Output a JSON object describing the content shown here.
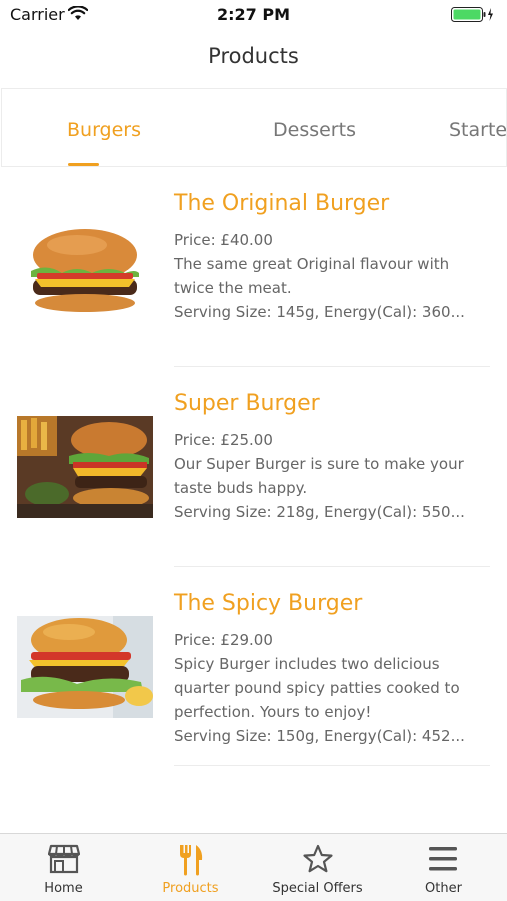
{
  "status_bar": {
    "carrier": "Carrier",
    "time": "2:27 PM"
  },
  "nav": {
    "title": "Products"
  },
  "categories": [
    {
      "label": "Burgers",
      "active": true
    },
    {
      "label": "Desserts",
      "active": false
    },
    {
      "label": "Starters",
      "active": false
    }
  ],
  "products": [
    {
      "name": "The Original Burger",
      "price": "Price: £40.00",
      "description": "The same great Original flavour with twice the meat.",
      "serving": "Serving Size: 145g, Energy(Cal): 360..."
    },
    {
      "name": "Super Burger",
      "price": "Price: £25.00",
      "description": "Our Super Burger is sure to make your taste buds happy.",
      "serving": "Serving Size: 218g, Energy(Cal): 550..."
    },
    {
      "name": "The Spicy Burger",
      "price": "Price: £29.00",
      "description": "Spicy Burger includes two delicious quarter pound spicy patties cooked to perfection. Yours to enjoy!",
      "serving": "Serving Size: 150g, Energy(Cal): 452..."
    }
  ],
  "tab_bar": [
    {
      "label": "Home",
      "icon": "store-icon",
      "active": false
    },
    {
      "label": "Products",
      "icon": "cutlery-icon",
      "active": true
    },
    {
      "label": "Special Offers",
      "icon": "star-icon",
      "active": false
    },
    {
      "label": "Other",
      "icon": "menu-icon",
      "active": false
    }
  ],
  "colors": {
    "accent": "#f0a020",
    "battery": "#4cd964"
  }
}
